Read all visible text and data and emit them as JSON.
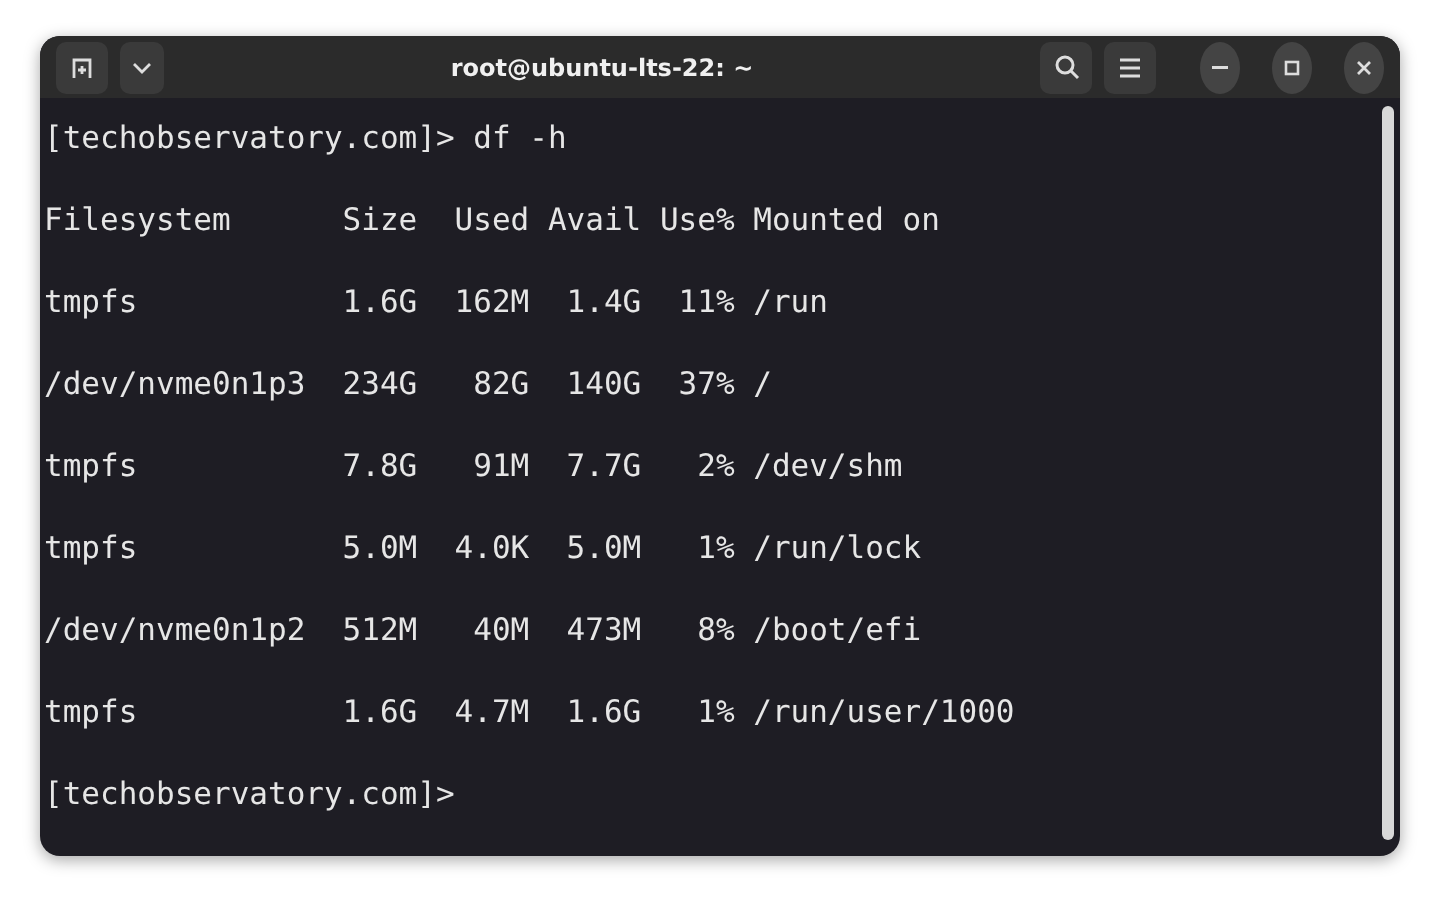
{
  "window": {
    "title": "root@ubuntu-lts-22: ~"
  },
  "terminal": {
    "lines": [
      "[techobservatory.com]> df -h",
      "Filesystem      Size  Used Avail Use% Mounted on",
      "tmpfs           1.6G  162M  1.4G  11% /run",
      "/dev/nvme0n1p3  234G   82G  140G  37% /",
      "tmpfs           7.8G   91M  7.7G   2% /dev/shm",
      "tmpfs           5.0M  4.0K  5.0M   1% /run/lock",
      "/dev/nvme0n1p2  512M   40M  473M   8% /boot/efi",
      "tmpfs           1.6G  4.7M  1.6G   1% /run/user/1000",
      "[techobservatory.com]>"
    ]
  }
}
